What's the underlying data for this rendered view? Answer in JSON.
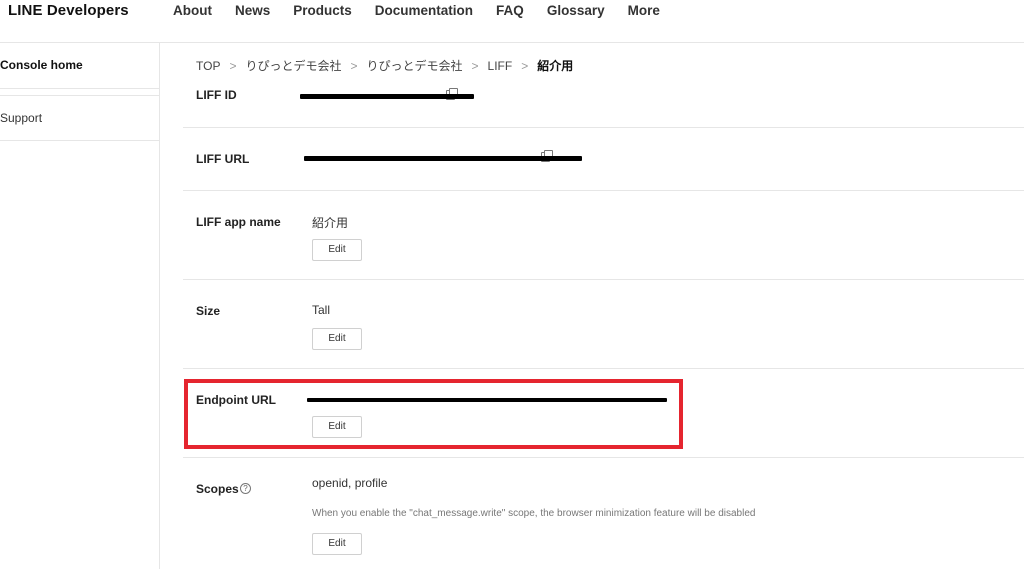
{
  "brand": "LINE Developers",
  "nav": [
    "About",
    "News",
    "Products",
    "Documentation",
    "FAQ",
    "Glossary",
    "More"
  ],
  "sidebar": {
    "items": [
      {
        "label": "Console home"
      },
      {
        "label": "Support"
      }
    ]
  },
  "breadcrumb": [
    "TOP",
    "りぴっとデモ会社",
    "りぴっとデモ会社",
    "LIFF",
    "紹介用"
  ],
  "breadcrumb_separator": ">",
  "rows": {
    "liff_id": {
      "label": "LIFF ID"
    },
    "liff_url": {
      "label": "LIFF URL"
    },
    "app_name": {
      "label": "LIFF app name",
      "value": "紹介用",
      "button": "Edit"
    },
    "size": {
      "label": "Size",
      "value": "Tall",
      "button": "Edit"
    },
    "endpoint": {
      "label": "Endpoint URL",
      "button": "Edit"
    },
    "scopes": {
      "label": "Scopes",
      "help": "?",
      "value": "openid, profile",
      "note": "When you enable the \"chat_message.write\" scope, the browser minimization feature will be disabled",
      "button": "Edit"
    }
  },
  "colors": {
    "highlight": "#e5252f",
    "border": "#e6e6e6"
  }
}
